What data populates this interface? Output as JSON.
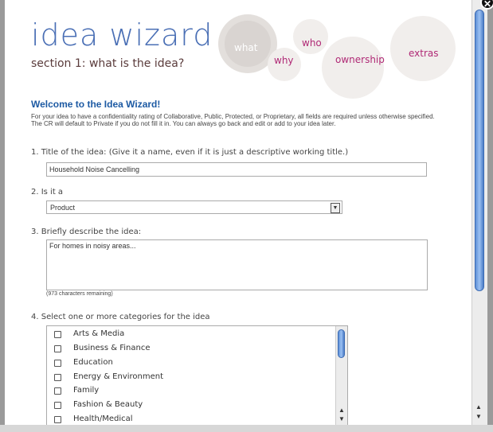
{
  "header": {
    "title": "idea wizard",
    "subtitle": "section 1: what is the idea?"
  },
  "steps": [
    "what",
    "why",
    "who",
    "ownership",
    "extras"
  ],
  "welcome": "Welcome to the Idea Wizard!",
  "intro": "For your idea to have a confidentiality rating of Collaborative, Public, Protected, or Proprietary, all fields are required unless otherwise specified. The CR will default to Private if you do not fill it in. You can always go back and edit or add to your idea later.",
  "q1": {
    "label": "1.  Title of the idea: (Give it a name, even if it is just a descriptive working title.)",
    "value": "Household Noise Cancelling"
  },
  "q2": {
    "label": "2.  Is it a",
    "value": "Product"
  },
  "q3": {
    "label": "3.  Briefly describe the idea:",
    "value": "For homes in noisy areas...",
    "chars": "(973 characters remaining)"
  },
  "q4": {
    "label": "4.  Select one or more categories for the idea",
    "categories": [
      "Arts & Media",
      "Business & Finance",
      "Education",
      "Energy & Environment",
      "Family",
      "Fashion & Beauty",
      "Health/Medical"
    ]
  },
  "colors": {
    "title": "#4a6fb5",
    "step": "#b02a76",
    "welcome": "#1d5aa3",
    "gear": "#ebe7e4"
  }
}
